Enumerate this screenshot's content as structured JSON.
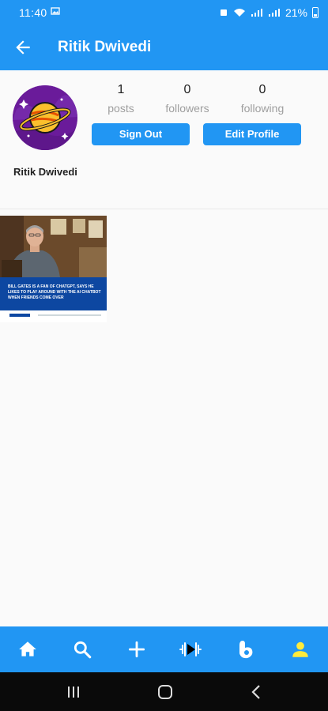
{
  "status_bar": {
    "time": "11:40",
    "battery": "21%"
  },
  "app_bar": {
    "title": "Ritik Dwivedi"
  },
  "profile": {
    "username": "Ritik Dwivedi",
    "stats": [
      {
        "value": "1",
        "label": "posts"
      },
      {
        "value": "0",
        "label": "followers"
      },
      {
        "value": "0",
        "label": "following"
      }
    ],
    "buttons": {
      "sign_out": "Sign Out",
      "edit_profile": "Edit Profile"
    }
  },
  "posts": [
    {
      "caption": "BILL GATES IS A FAN OF CHATGPT, SAYS HE LIKES TO PLAY AROUND WITH THE AI CHATBOT WHEN FRIENDS COME OVER"
    }
  ],
  "bottom_nav": [
    "home-icon",
    "search-icon",
    "add-icon",
    "reels-icon",
    "likes-icon",
    "profile-icon"
  ],
  "colors": {
    "primary": "#2196f3",
    "background": "#fafafa",
    "stat_label": "#9e9e9e",
    "nav_active": "#ffeb3b"
  }
}
